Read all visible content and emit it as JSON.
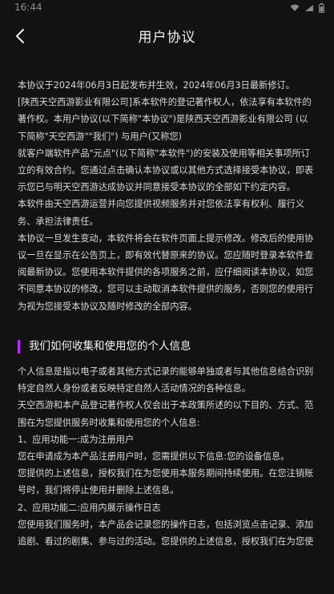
{
  "status_bar": {
    "time": "16:44"
  },
  "header": {
    "title": "用户协议"
  },
  "intro_paragraphs": [
    "本协议于2024年06月3日起发布并生效，2024年06月3日最新修订。",
    "[陕西天空西游影业有限公司]系本软件的登记著作权人，依法享有本软件的著作权。本用户协议(以下简称\"本协议\")是陕西天空西游影业有限公司 (以下简称\"天空西游\"\"我们\") 与用户(又称您)",
    "就客户端软件产品\"元点\"(以下简称\"本软件\")的安装及使用等相关事项所订立的有效合约。您通过点击确认本协议或以其他方式选择接受本协议，即表示您已与明天空西游达成协议并同意接受本协议的全部如下约定内容。",
    "本软件由天空西游运营并向您提供视频服务并对您依法享有权利、履行义务、承担法律责任。",
    "本协议一旦发生变动，本软件将会在软件页面上提示修改。修改后的使用协议一旦在显示在公告页上，即有效代替原来的协议。您应随时登录本软件查阅最新协议。您使用本软件提供的各项服务之前，应仔细阅读本协议，如您不同意本协议的修改，您可以主动取消本软件提供的服务，否则您的使用行为视为您接受本协议及随时修改的全部内容。"
  ],
  "section": {
    "heading": "我们如何收集和使用您的个人信息",
    "paragraphs": [
      "个人信息是指以电子或者其他方式记录的能够单独或者与其他信息结合识别特定自然人身份或者反映特定自然人活动情况的各种信息。",
      "天空西游和本产品登记著作权人仅会出于本政策所述的以下目的、方式、范围在为您提供服务时收集和使用您的个人信息:",
      "1、应用功能一:成为注册用户",
      "您在申请成为本产品注册用户时，您需提供以下信息:您的设备信息。",
      "您提供的上述信息，授权我们在为您使用本服务期间持续使用。在您注销账号时，我们将停止使用并删除上述信息。",
      "2、应用功能二:应用内展示操作日志",
      "您使用我们服务时，本产品会记录您的操作日志，包括浏览点击记录、添加追剧、看过的剧集、参与过的活动。您提供的上述信息，授权我们在为您使"
    ]
  },
  "colors": {
    "background": "#121212",
    "accent": "#c02bff",
    "text": "#d8d8d8"
  },
  "icons": {
    "back": "chevron-left-icon",
    "wifi": "wifi-icon",
    "signal": "signal-icon",
    "battery": "battery-icon"
  }
}
